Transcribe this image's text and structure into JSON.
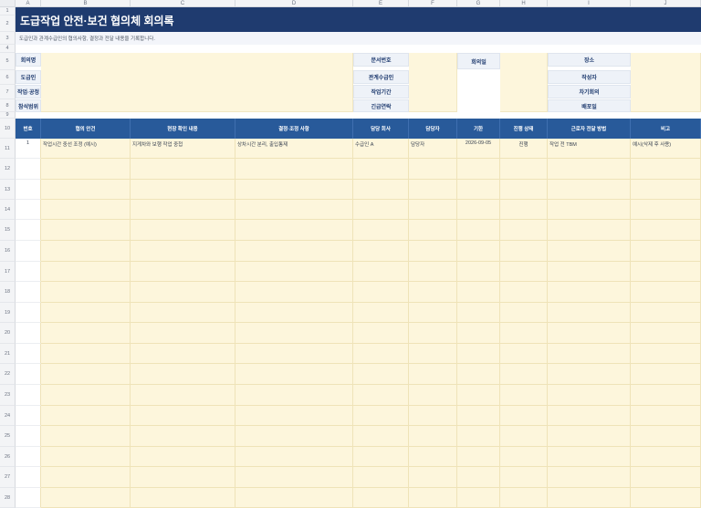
{
  "sheet": {
    "columns": [
      "A",
      "B",
      "C",
      "D",
      "E",
      "F",
      "G",
      "H",
      "I",
      "J"
    ],
    "rows": [
      "1",
      "2",
      "3",
      "4",
      "5",
      "6",
      "7",
      "8",
      "9",
      "10",
      "11",
      "12",
      "13",
      "14",
      "15",
      "16",
      "17",
      "18",
      "19",
      "20",
      "21",
      "22",
      "23",
      "24",
      "25",
      "26",
      "27",
      "28"
    ]
  },
  "title": "도급작업 안전·보건 협의체 회의록",
  "subtitle": "도급인과 관계수급인의 협의사항, 결정과 전달 내용을 기록합니다.",
  "info_labels": {
    "meeting_name": "회의명",
    "contractor": "도급인",
    "work_process": "작업·공정",
    "attendees": "참석범위",
    "doc_number": "문서번호",
    "subcontractor": "관계수급인",
    "work_period": "작업기간",
    "emergency": "긴급연락",
    "meeting_date": "회의일",
    "location": "장소",
    "author": "작성자",
    "next_meeting": "차기회의",
    "distribution": "배포일"
  },
  "table": {
    "headers": [
      "번호",
      "협의 안건",
      "현장 확인 내용",
      "결정·조정 사항",
      "담당 회사",
      "담당자",
      "기한",
      "진행 상태",
      "근로자 전달 방법",
      "비고"
    ],
    "rows": [
      [
        "1",
        "작업시간 중선 조정 (예시)",
        "지게차와 보행 작업 중첩",
        "상차시간 분리, 출입통제",
        "수급인 A",
        "담당자",
        "2026-09-05",
        "진행",
        "작업 전 TBM",
        "예시(삭제 후 사용)"
      ]
    ]
  }
}
